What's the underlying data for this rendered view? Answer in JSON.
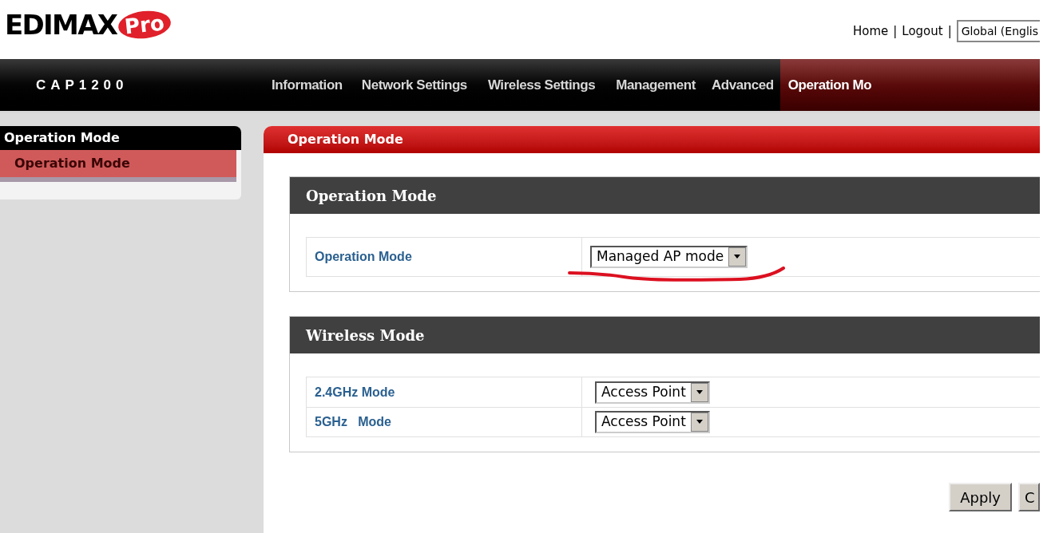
{
  "logo": {
    "brand": "EDIMAX",
    "badge": "Pro"
  },
  "header_links": [
    {
      "label": "Home"
    },
    {
      "label": "Logout"
    }
  ],
  "separator": "|",
  "language_select": {
    "value": "Global (Englis"
  },
  "nav": {
    "device": "CAP1200",
    "items": [
      {
        "label": "Information",
        "selected": false
      },
      {
        "label": "Network Settings",
        "selected": false
      },
      {
        "label": "Wireless Settings",
        "selected": false
      },
      {
        "label": "Management",
        "selected": false
      },
      {
        "label": "Advanced",
        "selected": false
      },
      {
        "label": "Operation Mo",
        "selected": true
      }
    ]
  },
  "sidebar": {
    "title": "Operation Mode",
    "items": [
      {
        "label": "Operation Mode",
        "selected": true
      }
    ]
  },
  "panel": {
    "title": "Operation Mode",
    "sections": [
      {
        "title": "Operation Mode",
        "rows": [
          {
            "label": "Operation Mode",
            "value": "Managed AP mode",
            "marked": true
          }
        ]
      },
      {
        "title": "Wireless Mode",
        "rows": [
          {
            "label": "2.4GHz Mode",
            "value": "Access Point",
            "marked": false
          },
          {
            "label": "5GHz   Mode",
            "value": "Access Point",
            "marked": false
          }
        ]
      }
    ]
  },
  "buttons": [
    "Apply",
    "C"
  ]
}
